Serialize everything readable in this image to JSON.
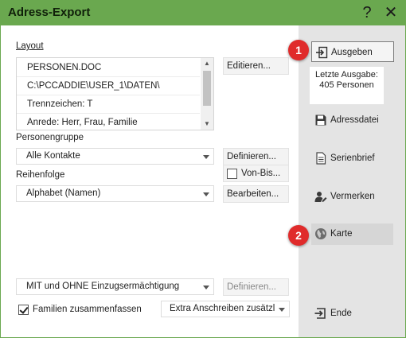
{
  "window": {
    "title": "Adress-Export",
    "help_glyph": "?",
    "close_glyph": "✕"
  },
  "layout": {
    "label": "Layout",
    "items": [
      "PERSONEN.DOC",
      "C:\\PCCADDIE\\USER_1\\DATEN\\",
      "Trennzeichen: T",
      "Anrede: Herr, Frau, Familie"
    ],
    "edit_button": "Editieren..."
  },
  "personengruppe": {
    "label": "Personengruppe",
    "value": "Alle Kontakte",
    "define_button": "Definieren...",
    "vonbis_label": "Von-Bis..."
  },
  "reihenfolge": {
    "label": "Reihenfolge",
    "value": "Alphabet (Namen)",
    "edit_button": "Bearbeiten..."
  },
  "mandate": {
    "value": "MIT und OHNE Einzugsermächtigung",
    "define_button": "Definieren..."
  },
  "familien": {
    "label": "Familien zusammenfassen",
    "checked": true,
    "extra_value": "Extra Anschreiben zusätzl"
  },
  "sidebar": {
    "ausgeben": "Ausgeben",
    "info_line1": "Letzte Ausgabe:",
    "info_line2": "405 Personen",
    "adressdatei": "Adressdatei",
    "serienbrief": "Serienbrief",
    "vermerken": "Vermerken",
    "karte": "Karte",
    "ende": "Ende"
  },
  "badges": [
    "1",
    "2"
  ],
  "colors": {
    "titlebar": "#6aa84f",
    "side_pane": "#e4e4e4",
    "badge": "#e02b2b"
  }
}
